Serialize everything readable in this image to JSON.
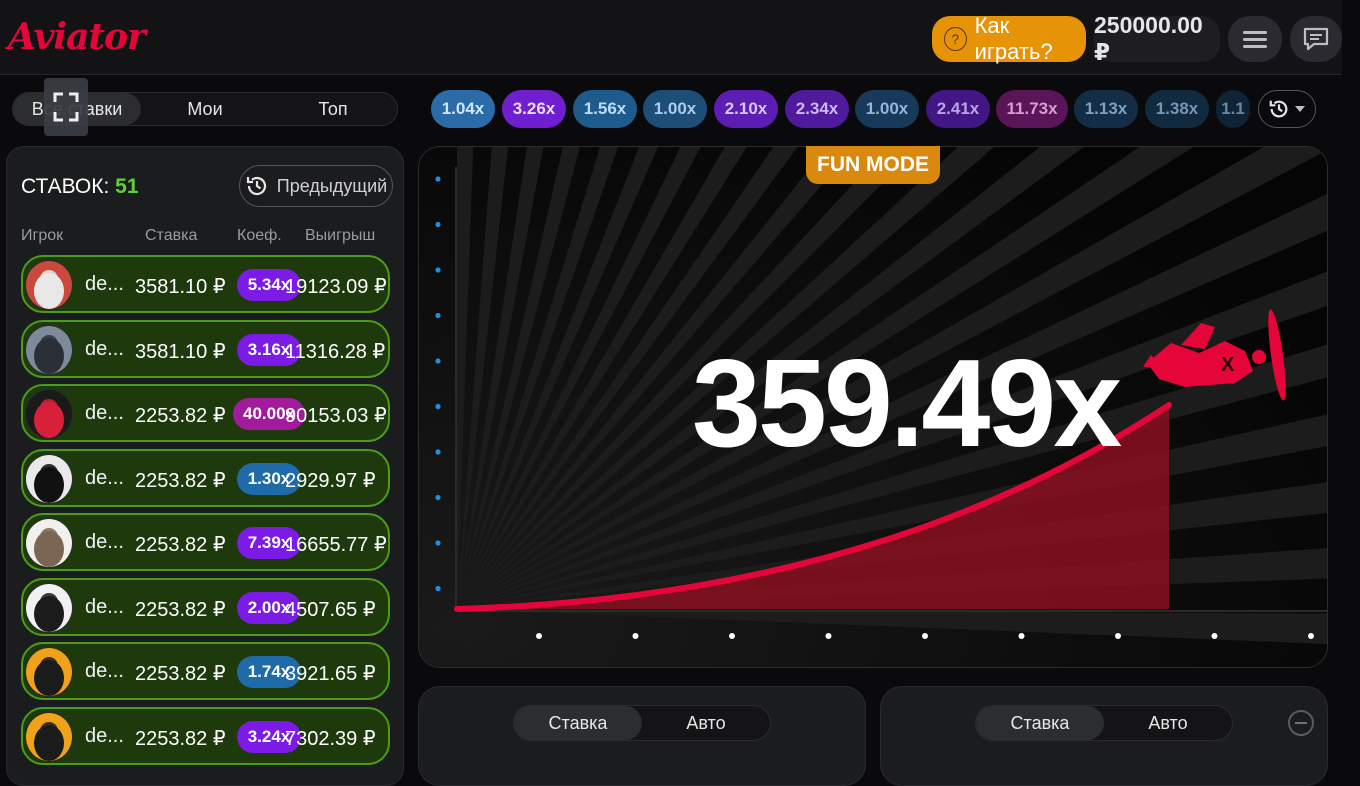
{
  "header": {
    "logo": "Aviator",
    "how_to_play": "Как играть?",
    "balance": "250000.00 ₽"
  },
  "left": {
    "tabs": [
      "Все ставки",
      "Мои",
      "Топ"
    ],
    "bets_label": "СТАВОК:",
    "bets_count": "51",
    "prev_button": "Предыдущий",
    "columns": [
      "Игрок",
      "Ставка",
      "Коеф.",
      "Выигрыш"
    ],
    "rows": [
      {
        "name": "de...",
        "bet": "3581.10 ₽",
        "coef": "5.34x",
        "coef_color": "#7b1be5",
        "win": "19123.09 ₽"
      },
      {
        "name": "de...",
        "bet": "3581.10 ₽",
        "coef": "3.16x",
        "coef_color": "#7b1be5",
        "win": "11316.28 ₽"
      },
      {
        "name": "de...",
        "bet": "2253.82 ₽",
        "coef": "40.00x",
        "coef_color": "#a21b9c",
        "win": "90153.03 ₽"
      },
      {
        "name": "de...",
        "bet": "2253.82 ₽",
        "coef": "1.30x",
        "coef_color": "#1f6aa8",
        "win": "2929.97 ₽"
      },
      {
        "name": "de...",
        "bet": "2253.82 ₽",
        "coef": "7.39x",
        "coef_color": "#7b1be5",
        "win": "16655.77 ₽"
      },
      {
        "name": "de...",
        "bet": "2253.82 ₽",
        "coef": "2.00x",
        "coef_color": "#7b1be5",
        "win": "4507.65 ₽"
      },
      {
        "name": "de...",
        "bet": "2253.82 ₽",
        "coef": "1.74x",
        "coef_color": "#1f6aa8",
        "win": "3921.65 ₽"
      },
      {
        "name": "de...",
        "bet": "2253.82 ₽",
        "coef": "3.24x",
        "coef_color": "#7b1be5",
        "win": "7302.39 ₽"
      }
    ]
  },
  "history": [
    {
      "value": "1.04x",
      "color": "#2b6ca8",
      "text": "#cfe6ff"
    },
    {
      "value": "3.26x",
      "color": "#6f1fd0",
      "text": "#e8dbff"
    },
    {
      "value": "1.56x",
      "color": "#1f5a8c",
      "text": "#bcdcff"
    },
    {
      "value": "1.00x",
      "color": "#1d4e78",
      "text": "#a9cdf0"
    },
    {
      "value": "2.10x",
      "color": "#5c1db3",
      "text": "#d8c7ff"
    },
    {
      "value": "2.34x",
      "color": "#4f1a9c",
      "text": "#cbb8f5"
    },
    {
      "value": "1.00x",
      "color": "#17395a",
      "text": "#93b7d8"
    },
    {
      "value": "2.41x",
      "color": "#421783",
      "text": "#b9a3e6"
    },
    {
      "value": "11.73x",
      "color": "#5a1558",
      "text": "#d59bd2"
    },
    {
      "value": "1.13x",
      "color": "#142d46",
      "text": "#7fa0bf"
    },
    {
      "value": "1.38x",
      "color": "#122a40",
      "text": "#7595b3"
    },
    {
      "value": "1.1",
      "color": "#0f2336",
      "text": "#6786a3"
    }
  ],
  "game": {
    "fun_mode": "FUN MODE",
    "multiplier": "359.49x",
    "curve_color": "#e50539"
  },
  "bet_panels": [
    {
      "tabs": [
        "Ставка",
        "Авто"
      ]
    },
    {
      "tabs": [
        "Ставка",
        "Авто"
      ]
    }
  ]
}
